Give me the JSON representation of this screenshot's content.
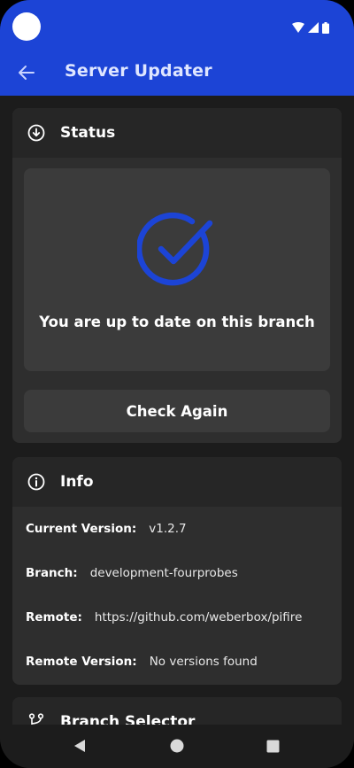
{
  "app": {
    "title": "Server Updater"
  },
  "colors": {
    "primary": "#1c44d6",
    "background": "#1c1c1c",
    "card": "#2e2e2e",
    "card_header": "#262626",
    "panel": "#3b3b3b"
  },
  "status": {
    "title": "Status",
    "icon": "download-circle-icon",
    "message": "You are up to date on this branch",
    "state_icon": "check-circle-icon",
    "check_button": "Check Again"
  },
  "info": {
    "title": "Info",
    "icon": "info-circle-icon",
    "rows": [
      {
        "label": "Current Version:",
        "value": "v1.2.7"
      },
      {
        "label": "Branch:",
        "value": "development-fourprobes"
      },
      {
        "label": "Remote:",
        "value": "https://github.com/weberbox/pifire"
      },
      {
        "label": "Remote Version:",
        "value": "No versions found"
      }
    ]
  },
  "branch_selector": {
    "title": "Branch Selector",
    "icon": "source-branch-icon"
  },
  "navigation": {
    "back": "back-triangle-icon",
    "home": "home-circle-icon",
    "recents": "recents-square-icon"
  }
}
